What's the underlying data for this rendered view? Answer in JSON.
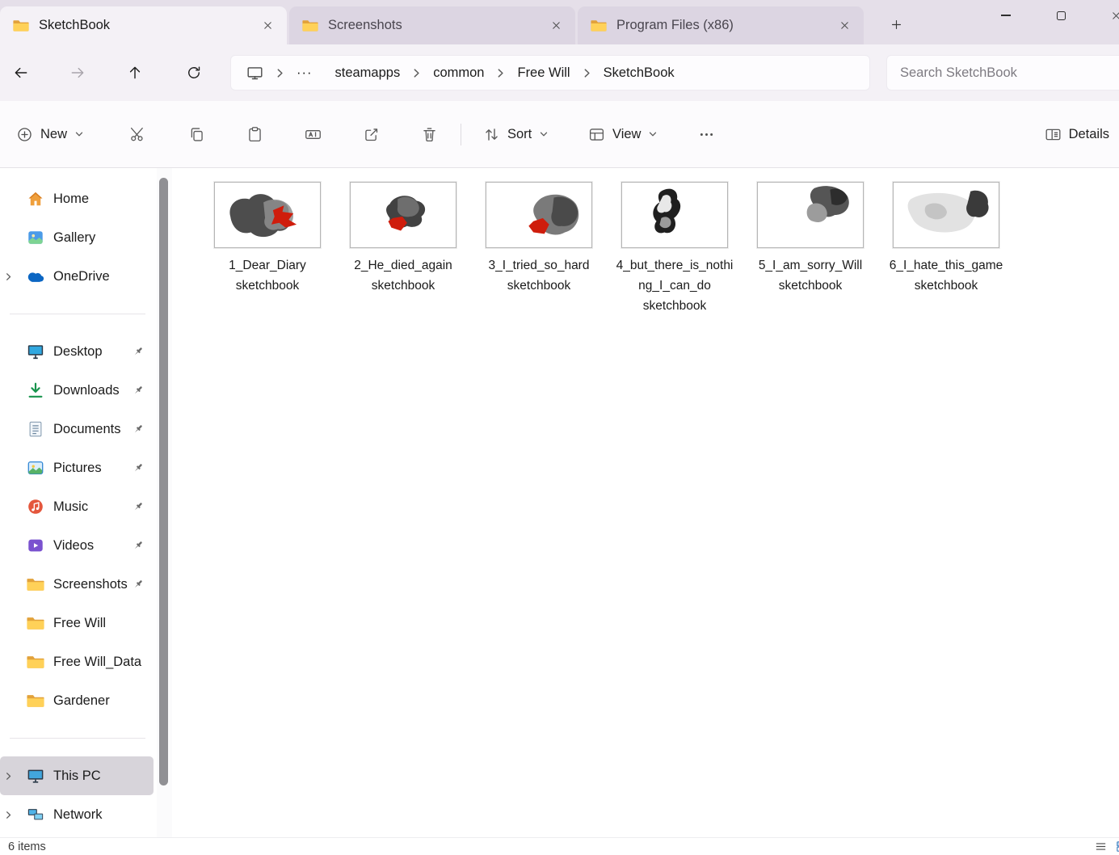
{
  "window": {
    "tabs": [
      {
        "label": "SketchBook"
      },
      {
        "label": "Screenshots"
      },
      {
        "label": "Program Files (x86)"
      }
    ]
  },
  "navbar": {
    "breadcrumb_overflow": "···",
    "breadcrumbs": [
      "steamapps",
      "common",
      "Free Will",
      "SketchBook"
    ],
    "search_placeholder": "Search SketchBook"
  },
  "toolbar": {
    "new_label": "New",
    "sort_label": "Sort",
    "view_label": "View",
    "details_label": "Details"
  },
  "sidebar": {
    "items": [
      {
        "label": "Home",
        "icon": "home-icon"
      },
      {
        "label": "Gallery",
        "icon": "gallery-icon"
      },
      {
        "label": "OneDrive",
        "icon": "onedrive-icon",
        "expandable": true
      },
      {
        "label": "Desktop",
        "icon": "desktop-icon",
        "pinned": true
      },
      {
        "label": "Downloads",
        "icon": "downloads-icon",
        "pinned": true
      },
      {
        "label": "Documents",
        "icon": "documents-icon",
        "pinned": true
      },
      {
        "label": "Pictures",
        "icon": "pictures-icon",
        "pinned": true
      },
      {
        "label": "Music",
        "icon": "music-icon",
        "pinned": true
      },
      {
        "label": "Videos",
        "icon": "videos-icon",
        "pinned": true
      },
      {
        "label": "Screenshots",
        "icon": "folder-icon",
        "pinned": true
      },
      {
        "label": "Free Will",
        "icon": "folder-icon"
      },
      {
        "label": "Free Will_Data",
        "icon": "folder-icon"
      },
      {
        "label": "Gardener",
        "icon": "folder-icon"
      },
      {
        "label": "This PC",
        "icon": "this-pc-icon",
        "expandable": true,
        "selected": true
      },
      {
        "label": "Network",
        "icon": "network-icon",
        "expandable": true
      }
    ]
  },
  "files": [
    {
      "name": "1_Dear_Diary sketchbook"
    },
    {
      "name": "2_He_died_again sketchbook"
    },
    {
      "name": "3_I_tried_so_hard sketchbook"
    },
    {
      "name": "4_but_there_is_nothing_I_can_do sketchbook"
    },
    {
      "name": "5_I_am_sorry_Will sketchbook"
    },
    {
      "name": "6_I_hate_this_game sketchbook"
    }
  ],
  "statusbar": {
    "item_count": "6 items"
  },
  "colors": {
    "accent_red": "#cf1d0c",
    "folder_yellow": "#ffd158",
    "selection_gray": "#d7d4da",
    "mica_background": "#e5dfe9"
  }
}
